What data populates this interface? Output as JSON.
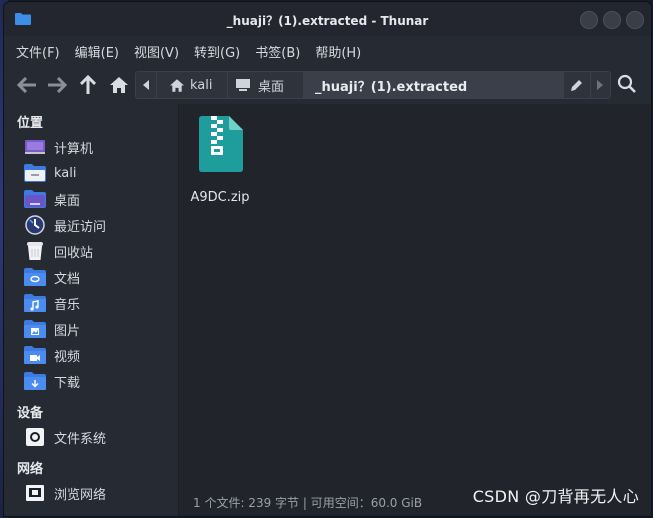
{
  "window": {
    "title": "_huaji？(1).extracted - Thunar"
  },
  "menubar": [
    "文件(F)",
    "编辑(E)",
    "视图(V)",
    "转到(G)",
    "书签(B)",
    "帮助(H)"
  ],
  "toolbar": {
    "path_segments": [
      "kali",
      "桌面",
      "_huaji？(1).extracted"
    ]
  },
  "sidebar": {
    "places_header": "位置",
    "places": [
      {
        "label": "计算机",
        "icon": "computer-icon"
      },
      {
        "label": "kali",
        "icon": "home-folder-icon"
      },
      {
        "label": "桌面",
        "icon": "desktop-icon"
      },
      {
        "label": "最近访问",
        "icon": "recent-icon"
      },
      {
        "label": "回收站",
        "icon": "trash-icon"
      },
      {
        "label": "文档",
        "icon": "documents-folder-icon"
      },
      {
        "label": "音乐",
        "icon": "music-folder-icon"
      },
      {
        "label": "图片",
        "icon": "pictures-folder-icon"
      },
      {
        "label": "视频",
        "icon": "videos-folder-icon"
      },
      {
        "label": "下载",
        "icon": "downloads-folder-icon"
      }
    ],
    "devices_header": "设备",
    "devices": [
      {
        "label": "文件系统",
        "icon": "filesystem-icon"
      }
    ],
    "network_header": "网络",
    "network": [
      {
        "label": "浏览网络",
        "icon": "network-icon"
      }
    ]
  },
  "files": [
    {
      "name": "A9DC.zip",
      "icon": "zip-archive-icon"
    }
  ],
  "status": "1 个文件: 239 字节 | 可用空间：60.0 GiB",
  "watermark": "CSDN @刀背再无人心",
  "colors": {
    "folder_blue": "#3d7be0",
    "zip_teal": "#1f9c9c",
    "window_bg": "#262a33"
  }
}
